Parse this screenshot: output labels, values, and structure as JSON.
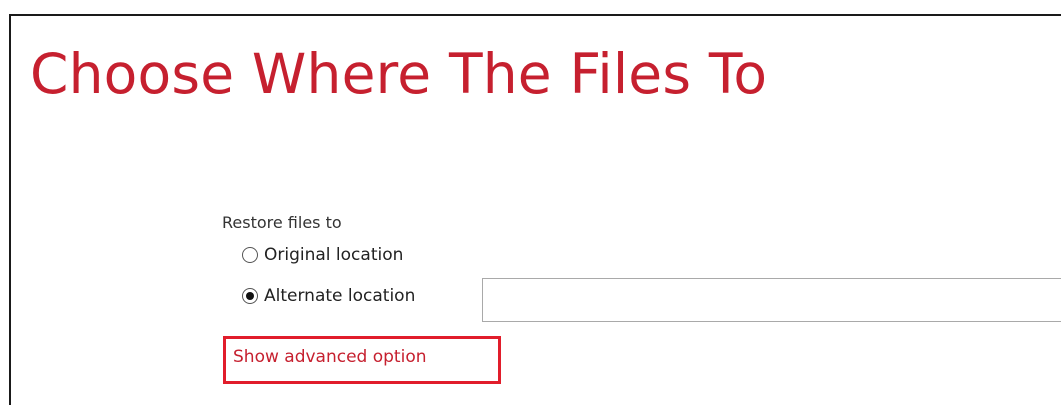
{
  "page": {
    "title": "Choose Where The Files To"
  },
  "restore": {
    "label": "Restore files to",
    "options": [
      {
        "label": "Original location",
        "selected": false
      },
      {
        "label": "Alternate location",
        "selected": true
      }
    ],
    "alternate_path_value": ""
  },
  "advanced": {
    "link_label": "Show advanced option",
    "highlight_color": "#e11d2b"
  },
  "colors": {
    "accent": "#c6202f",
    "text": "#333333"
  }
}
